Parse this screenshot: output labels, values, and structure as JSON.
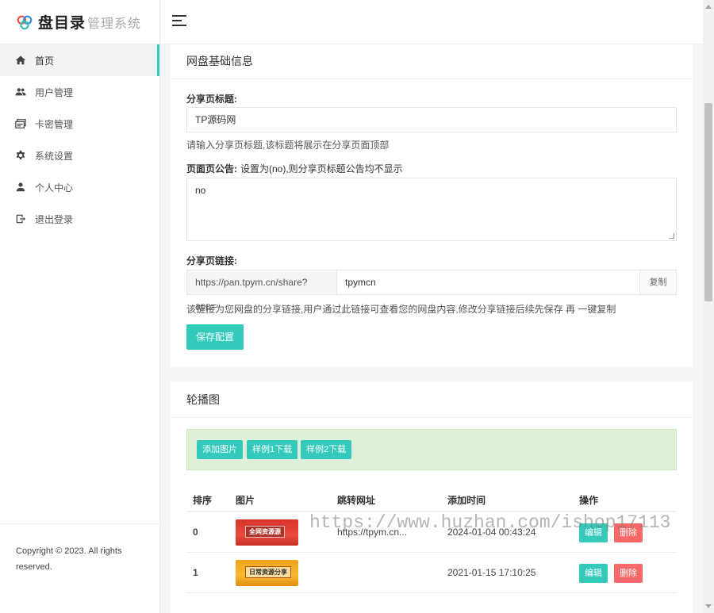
{
  "app": {
    "logo_main": "盘目录",
    "logo_sub": "管理系统"
  },
  "sidebar": {
    "items": [
      {
        "label": "首页",
        "icon": "home-icon"
      },
      {
        "label": "用户管理",
        "icon": "users-icon"
      },
      {
        "label": "卡密管理",
        "icon": "cards-icon"
      },
      {
        "label": "系统设置",
        "icon": "gear-icon"
      },
      {
        "label": "个人中心",
        "icon": "user-icon"
      },
      {
        "label": "退出登录",
        "icon": "logout-icon"
      }
    ],
    "active_index": 0,
    "footer": "Copyright © 2023. All rights reserved."
  },
  "colors": {
    "accent": "#33cabb",
    "danger": "#f96868",
    "alert_bg": "#dff0d8"
  },
  "basic": {
    "title": "网盘基础信息",
    "share_title_label": "分享页标题:",
    "share_title_value": "TP源码网",
    "share_title_help": "请输入分享页标题,该标题将展示在分享页面顶部",
    "notice_label": "页面页公告:",
    "notice_hint": "设置为(no),则分享页标题公告均不显示",
    "notice_value": "no",
    "link_label": "分享页链接:",
    "link_prefix": "https://pan.tpym.cn/share?app=",
    "link_value": "tpymcn",
    "copy_label": "复制",
    "link_help": "该链接为您网盘的分享链接,用户通过此链接可查看您的网盘内容,修改分享链接后续先保存 再 一键复制",
    "save_label": "保存配置"
  },
  "carousel": {
    "title": "轮播图",
    "buttons": [
      "添加图片",
      "样例1下载",
      "样例2下载"
    ],
    "columns": [
      "排序",
      "图片",
      "跳转网址",
      "添加时间",
      "操作"
    ],
    "rows": [
      {
        "order": "0",
        "image_text": "全网资源源",
        "url": "https://tpym.cn...",
        "time": "2024-01-04 00:43:24"
      },
      {
        "order": "1",
        "image_text": "日常资源分享",
        "url": "",
        "time": "2021-01-15 17:10:25"
      }
    ],
    "edit_label": "编辑",
    "delete_label": "删除"
  },
  "watermark": "https://www.huzhan.com/ishop17113"
}
